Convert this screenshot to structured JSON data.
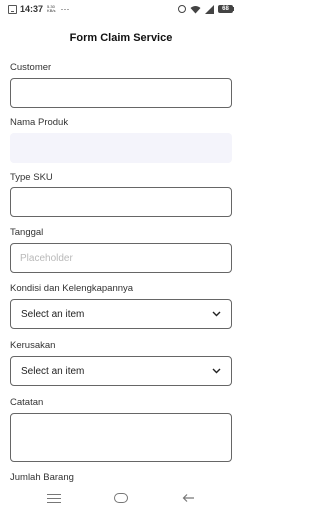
{
  "status_bar": {
    "time": "14:37",
    "speed_value": "5.30",
    "speed_unit": "KB/s",
    "more": "···",
    "battery": "68"
  },
  "page": {
    "title": "Form Claim Service"
  },
  "form": {
    "customer_label": "Customer",
    "customer_value": "",
    "nama_produk_label": "Nama Produk",
    "type_sku_label": "Type SKU",
    "type_sku_value": "",
    "tanggal_label": "Tanggal",
    "tanggal_placeholder": "Placeholder",
    "kondisi_label": "Kondisi dan Kelengkapannya",
    "kondisi_value": "Select an item",
    "kerusakan_label": "Kerusakan",
    "kerusakan_value": "Select an item",
    "catatan_label": "Catatan",
    "jumlah_label": "Jumlah Barang"
  },
  "icons": {
    "chevron": "chevron-down-icon",
    "nav_menu": "menu-icon",
    "nav_home": "home-icon",
    "nav_back": "back-icon"
  }
}
